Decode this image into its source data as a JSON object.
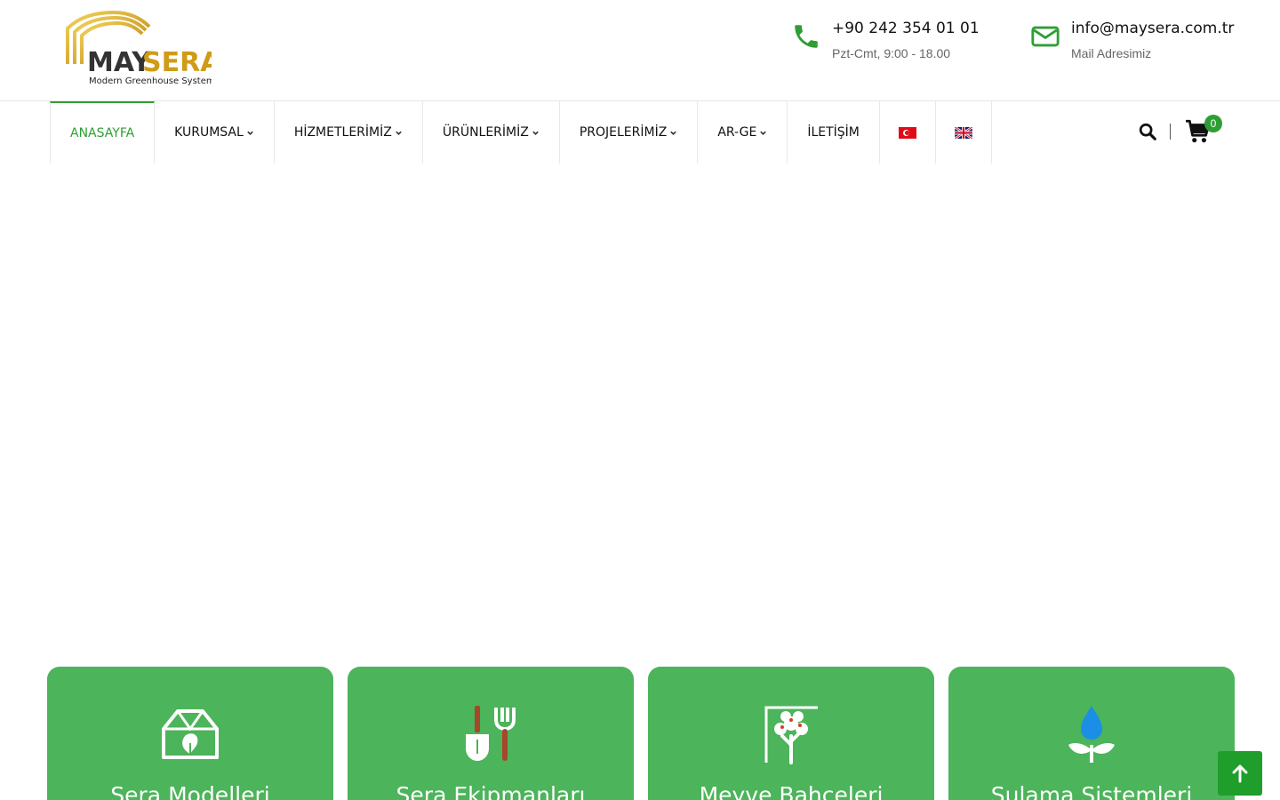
{
  "brand": {
    "name_part1": "MAY",
    "name_part2": "SERA",
    "tagline": "Modern Greenhouse Systems"
  },
  "contact": {
    "phone": "+90 242 354 01 01",
    "phone_hours": "Pzt-Cmt, 9:00 - 18.00",
    "email": "info@maysera.com.tr",
    "email_label": "Mail Adresimiz"
  },
  "nav": {
    "items": [
      {
        "label": "ANASAYFA",
        "active": true
      },
      {
        "label": "KURUMSAL"
      },
      {
        "label": "HİZMETLERİMİZ"
      },
      {
        "label": "ÜRÜNLERİMİZ"
      },
      {
        "label": "PROJELERİMİZ"
      },
      {
        "label": "AR-GE"
      },
      {
        "label": "İLETİŞİM"
      }
    ]
  },
  "cart": {
    "count": "0"
  },
  "cards": [
    {
      "title": "Sera Modelleri",
      "icon": "greenhouse-icon"
    },
    {
      "title": "Sera Ekipmanları",
      "icon": "garden-tools-icon"
    },
    {
      "title": "Meyve Bahçeleri",
      "icon": "tree-icon"
    },
    {
      "title": "Sulama Sistemleri",
      "icon": "water-drop-plant-icon"
    }
  ],
  "colors": {
    "accent": "#2e9e34",
    "card_bg": "#4cb45a",
    "logo_gold": "#d8a31a"
  }
}
